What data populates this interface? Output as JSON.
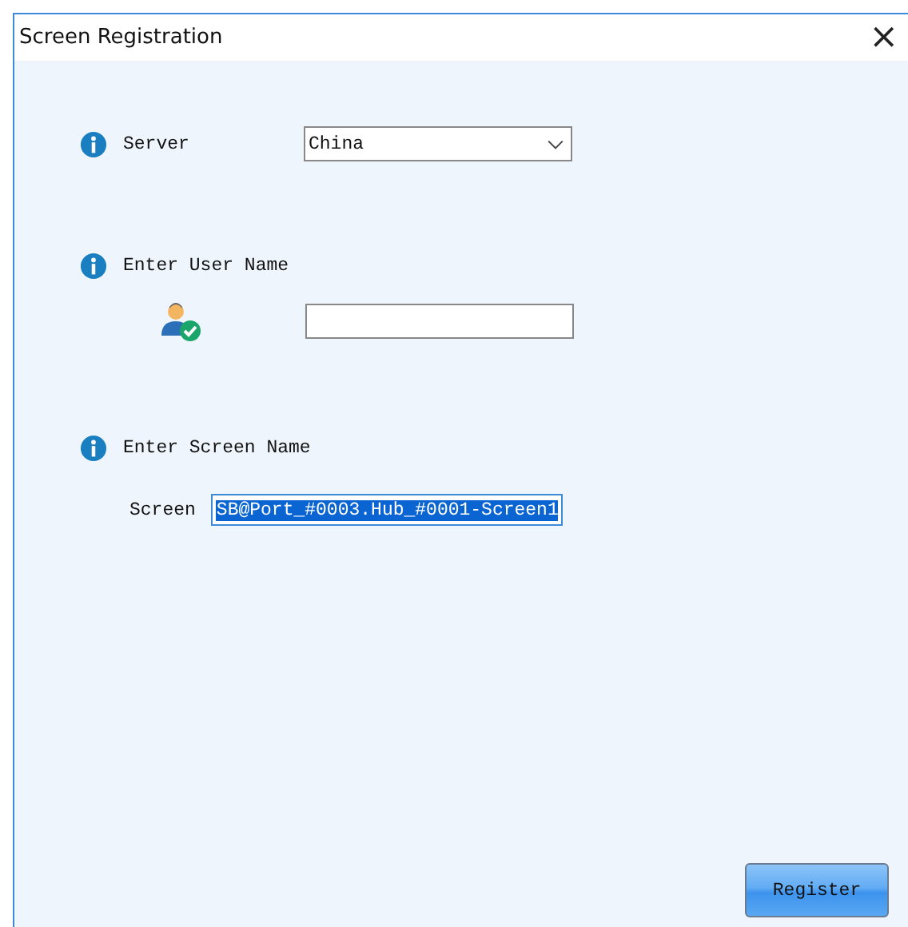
{
  "window": {
    "title": "Screen Registration",
    "close": "×"
  },
  "server": {
    "label": "Server",
    "value": "China"
  },
  "user_name": {
    "label": "Enter User Name"
  },
  "screen_name": {
    "label": "Enter Screen Name",
    "field_label": "Screen",
    "value": "SB@Port_#0003.Hub_#0001-Screen1",
    "text_selected": true
  },
  "buttons": [
    "Register"
  ]
}
